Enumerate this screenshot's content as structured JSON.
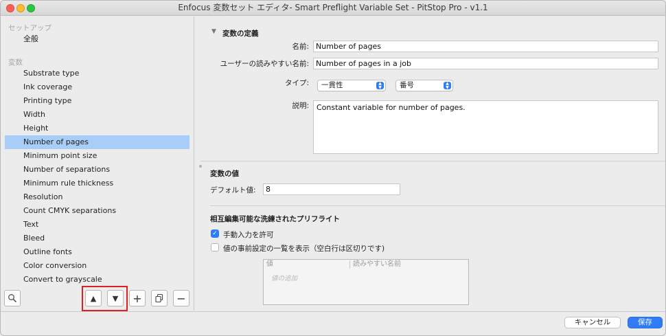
{
  "window": {
    "title": "Enfocus 変数セット エディタ- Smart Preflight Variable Set - PitStop Pro - v1.1"
  },
  "sidebar": {
    "setup_section": "セットアップ",
    "setup_items": [
      "全般"
    ],
    "variables_section": "変数",
    "variables": [
      "Substrate type",
      "Ink coverage",
      "Printing type",
      "Width",
      "Height",
      "Number of pages",
      "Minimum point size",
      "Number of separations",
      "Minimum rule thickness",
      "Resolution",
      "Count CMYK separations",
      "Text",
      "Bleed",
      "Outline fonts",
      "Color conversion",
      "Convert to grayscale"
    ],
    "selected_variable": "Number of pages",
    "tools": {
      "move_up": "▲",
      "move_down": "▼",
      "add": "+",
      "duplicate": "⧉",
      "remove": "−"
    }
  },
  "definition": {
    "header": "変数の定義",
    "name_label": "名前:",
    "name_value": "Number of pages",
    "readable_label": "ユーザーの読みやすい名前:",
    "readable_value": "Number of pages in a job",
    "type_label": "タイプ:",
    "type_value": "一貫性",
    "subtype_value": "番号",
    "description_label": "説明:",
    "description_value": "Constant variable for number of pages."
  },
  "value_section": {
    "header": "変数の値",
    "default_label": "デフォルト値:",
    "default_value": "8"
  },
  "smart_preflight": {
    "header": "相互編集可能な洗練されたプリフライト",
    "allow_manual_label": "手動入力を許可",
    "allow_manual_checked": true,
    "show_presets_label": "値の事前設定の一覧を表示（空白行は区切りです)",
    "show_presets_checked": false,
    "table_columns": [
      "値",
      "読みやすい名前"
    ],
    "add_value_placeholder": "値の追加"
  },
  "footer": {
    "cancel_label": "キャンセル",
    "save_label": "保存"
  },
  "colors": {
    "accent": "#2f7cf6",
    "selection": "#a9cdf9",
    "highlight_box": "#e02020"
  }
}
